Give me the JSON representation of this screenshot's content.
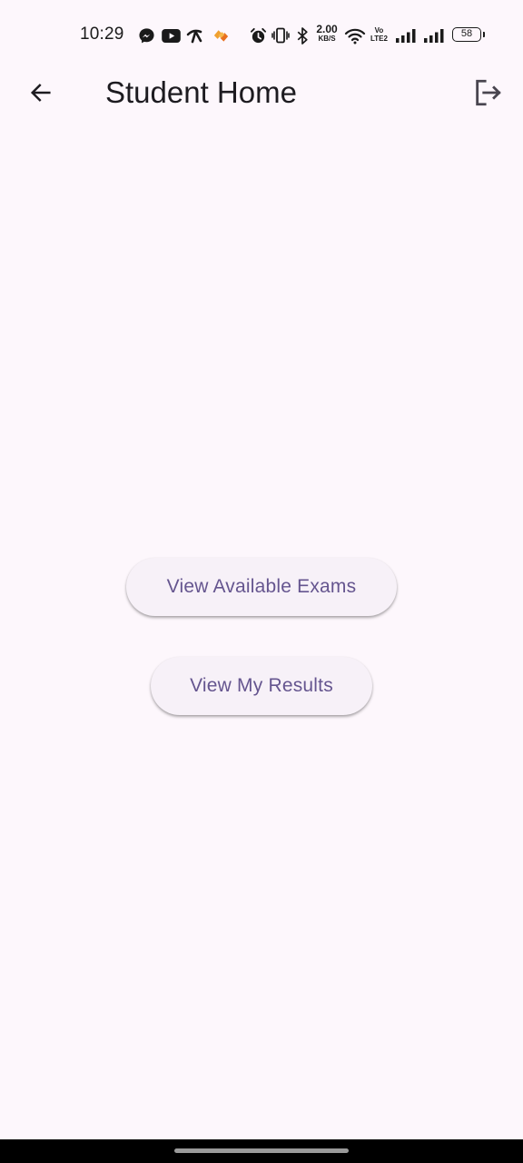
{
  "status_bar": {
    "time": "10:29",
    "net_speed_value": "2.00",
    "net_speed_unit": "KB/S",
    "volte_line1": "Vo",
    "volte_line2": "LTE2",
    "battery": "58",
    "icons": [
      "messenger-icon",
      "youtube-icon",
      "telenor-icon",
      "app-heart-icon",
      "alarm-icon",
      "vibrate-icon",
      "bluetooth-icon",
      "wifi-icon",
      "signal-icon",
      "signal-icon",
      "battery-icon"
    ]
  },
  "app_bar": {
    "title": "Student Home",
    "back_icon": "arrow-back-icon",
    "logout_icon": "logout-icon"
  },
  "actions": {
    "view_exams_label": "View Available Exams",
    "view_results_label": "View My Results"
  },
  "colors": {
    "background": "#fdf7fc",
    "button_surface": "#f7f1f8",
    "button_text": "#65558f",
    "title_text": "#1d1b20"
  }
}
